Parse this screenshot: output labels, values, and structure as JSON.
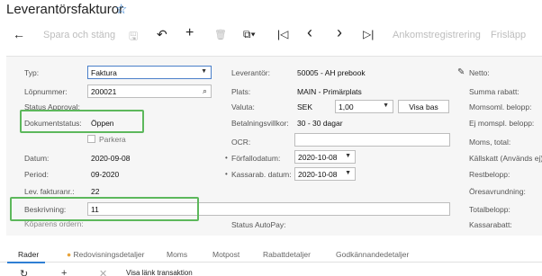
{
  "header": {
    "title": "Leverantörsfakturor",
    "favorite_icon": "star-outline-icon"
  },
  "toolbar": {
    "back_icon": "←",
    "save_close_label": "Spara och stäng",
    "save_icon": "🖫",
    "undo_icon": "↶",
    "add_icon": "+",
    "delete_icon": "🗑",
    "copy_icon": "⧉▾",
    "first_icon": "|◁",
    "prev_icon": "‹",
    "next_icon": "›",
    "last_icon": "▷|",
    "receipt_label": "Ankomstregistrering",
    "release_label": "Frisläpp"
  },
  "form": {
    "type_label": "Typ:",
    "type_value": "Faktura",
    "number_label": "Löpnummer:",
    "number_value": "200021",
    "status_approval_label": "Status Approval:",
    "doc_status_label": "Dokumentstatus:",
    "doc_status_value": "Öppen",
    "hold_label": "Parkera",
    "date_label": "Datum:",
    "date_value": "2020-09-08",
    "period_label": "Period:",
    "period_value": "09-2020",
    "vendor_invoice_label": "Lev. fakturanr.:",
    "vendor_invoice_value": "22",
    "description_label": "Beskrivning:",
    "description_value": "11",
    "buyer_label": "Köparens ordern:",
    "vendor_label": "Leverantör:",
    "vendor_value": "50005 - AH prebook",
    "location_label": "Plats:",
    "location_value": "MAIN - Primärplats",
    "currency_label": "Valuta:",
    "currency_value": "SEK",
    "rate_value": "1,00",
    "view_base_label": "Visa bas",
    "terms_label": "Betalningsvillkor:",
    "terms_value": "30 - 30 dagar",
    "ocr_label": "OCR:",
    "due_date_label": "Förfallodatum:",
    "due_date_value": "2020-10-08",
    "cash_disc_label": "Kassarab. datum:",
    "cash_disc_value": "2020-10-08",
    "autopay_label": "Status AutoPay:",
    "edit_icon": "✎",
    "net_label": "Netto:",
    "total_disc_label": "Summa rabatt:",
    "vat_taxable_label": "Momsoml. belopp:",
    "vat_exempt_label": "Ej momspl. belopp:",
    "vat_total_label": "Moms, total:",
    "withholding_label": "Källskatt (Används ej):",
    "balance_label": "Restbelopp:",
    "rounding_label": "Öresavrundning:",
    "total_label": "Totalbelopp:",
    "cash_discount_label": "Kassarabatt:"
  },
  "tabs": [
    "Rader",
    "Redovisningsdetaljer",
    "Moms",
    "Motpost",
    "Rabattdetaljer",
    "Godkännandedetaljer"
  ],
  "bottom": {
    "fragment": "Visa länk transaktion"
  }
}
